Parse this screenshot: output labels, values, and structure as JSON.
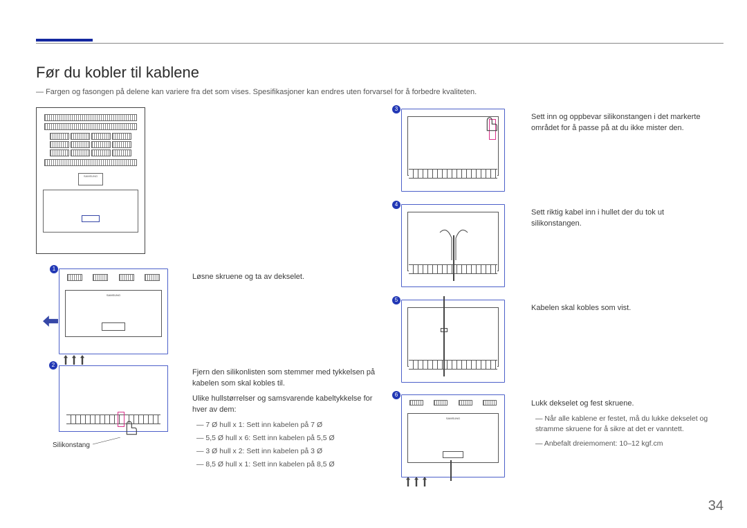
{
  "page_number": "34",
  "title": "Før du kobler til kablene",
  "intro_note": "Fargen og fasongen på delene kan variere fra det som vises. Spesifikasjoner kan endres uten forvarsel for å forbedre kvaliteten.",
  "main_diagram": {
    "logo_label": "SAMSUNG"
  },
  "label_silikonstang": "Silikonstang",
  "steps": {
    "s1": {
      "num": "1",
      "text": "Løsne skruene og ta av dekselet."
    },
    "s2": {
      "num": "2",
      "text": "Fjern den silikonlisten som stemmer med tykkelsen på kabelen som skal kobles til.",
      "sub_intro": "Ulike hullstørrelser og samsvarende kabeltykkelse for hver av dem:",
      "bullets": [
        "7 Ø hull x 1: Sett inn kabelen på 7 Ø",
        "5,5 Ø hull x 6: Sett inn kabelen på 5,5 Ø",
        "3 Ø hull x 2: Sett inn kabelen på 3 Ø",
        "8,5 Ø hull x 1: Sett inn kabelen på 8,5 Ø"
      ]
    },
    "s3": {
      "num": "3",
      "text": "Sett inn og oppbevar silikonstangen i det markerte området for å passe på at du ikke mister den."
    },
    "s4": {
      "num": "4",
      "text": "Sett riktig kabel inn i hullet der du tok ut silikonstangen."
    },
    "s5": {
      "num": "5",
      "text": "Kabelen skal kobles som vist."
    },
    "s6": {
      "num": "6",
      "text": "Lukk dekselet og fest skruene.",
      "bullets": [
        "Når alle kablene er festet, må du lukke dekselet og stramme skruene for å sikre at det er vanntett.",
        "Anbefalt dreiemoment: 10–12 kgf.cm"
      ]
    }
  }
}
